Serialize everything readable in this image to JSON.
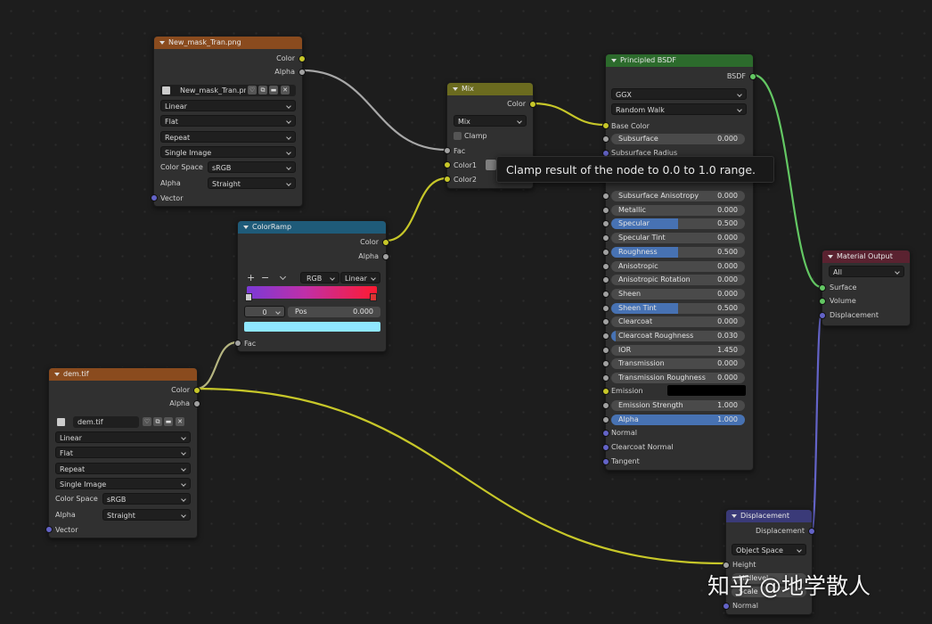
{
  "nodes": {
    "image1": {
      "title": "New_mask_Tran.png",
      "outputs": [
        "Color",
        "Alpha"
      ],
      "image_name": "New_mask_Tran.png",
      "interpolation": "Linear",
      "projection": "Flat",
      "extension": "Repeat",
      "source": "Single Image",
      "color_space_label": "Color Space",
      "color_space": "sRGB",
      "alpha_label": "Alpha",
      "alpha": "Straight",
      "input": "Vector"
    },
    "image2": {
      "title": "dem.tif",
      "outputs": [
        "Color",
        "Alpha"
      ],
      "image_name": "dem.tif",
      "interpolation": "Linear",
      "projection": "Flat",
      "extension": "Repeat",
      "source": "Single Image",
      "color_space_label": "Color Space",
      "color_space": "sRGB",
      "alpha_label": "Alpha",
      "alpha": "Straight",
      "input": "Vector"
    },
    "mix": {
      "title": "Mix",
      "output": "Color",
      "blend": "Mix",
      "clamp": "Clamp",
      "inputs": [
        "Fac",
        "Color1",
        "Color2"
      ]
    },
    "ramp": {
      "title": "ColorRamp",
      "outputs": [
        "Color",
        "Alpha"
      ],
      "plus": "+",
      "minus": "−",
      "color_mode": "RGB",
      "interp": "Linear",
      "index": "0",
      "pos_label": "Pos",
      "pos_value": "0.000",
      "input": "Fac"
    },
    "bsdf": {
      "title": "Principled BSDF",
      "output": "BSDF",
      "distribution": "GGX",
      "subsurface_method": "Random Walk",
      "base_color": "Base Color",
      "subsurface": {
        "label": "Subsurface",
        "value": "0.000",
        "fill": 0
      },
      "subsurface_radius": "Subsurface Radius",
      "fields": [
        {
          "label": "Subsurface Anisotropy",
          "value": "0.000",
          "fill": 0
        },
        {
          "label": "Metallic",
          "value": "0.000",
          "fill": 0
        },
        {
          "label": "Specular",
          "value": "0.500",
          "fill": 0.5
        },
        {
          "label": "Specular Tint",
          "value": "0.000",
          "fill": 0
        },
        {
          "label": "Roughness",
          "value": "0.500",
          "fill": 0.5
        },
        {
          "label": "Anisotropic",
          "value": "0.000",
          "fill": 0
        },
        {
          "label": "Anisotropic Rotation",
          "value": "0.000",
          "fill": 0
        },
        {
          "label": "Sheen",
          "value": "0.000",
          "fill": 0
        },
        {
          "label": "Sheen Tint",
          "value": "0.500",
          "fill": 0.5
        },
        {
          "label": "Clearcoat",
          "value": "0.000",
          "fill": 0
        },
        {
          "label": "Clearcoat Roughness",
          "value": "0.030",
          "fill": 0.03
        },
        {
          "label": "IOR",
          "value": "1.450",
          "fill": 0
        },
        {
          "label": "Transmission",
          "value": "0.000",
          "fill": 0
        },
        {
          "label": "Transmission Roughness",
          "value": "0.000",
          "fill": 0
        }
      ],
      "emission": "Emission",
      "emission_strength": {
        "label": "Emission Strength",
        "value": "1.000",
        "fill": 0
      },
      "alpha": {
        "label": "Alpha",
        "value": "1.000",
        "fill": 1
      },
      "bottom_inputs": [
        "Normal",
        "Clearcoat Normal",
        "Tangent"
      ]
    },
    "output": {
      "title": "Material Output",
      "target": "All",
      "inputs": [
        "Surface",
        "Volume",
        "Displacement"
      ]
    },
    "displacement": {
      "title": "Displacement",
      "output": "Displacement",
      "space": "Object Space",
      "inputs": [
        "Height",
        "Midlevel",
        "Scale",
        "Normal"
      ]
    }
  },
  "tooltip": "Clamp result of the node to 0.0 to 1.0 range.",
  "watermark": "知乎 @地学散人",
  "colors": {
    "socket_color": "#c7c729",
    "socket_float": "#a1a1a1",
    "socket_vector": "#6363c7",
    "socket_shader": "#63c763",
    "slider_fill": "#4772b3"
  }
}
